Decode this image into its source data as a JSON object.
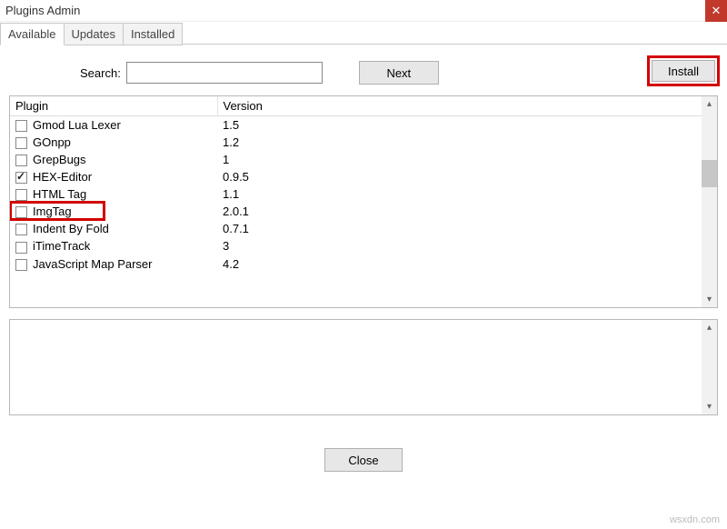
{
  "window": {
    "title": "Plugins Admin"
  },
  "tabs": [
    {
      "label": "Available",
      "active": true
    },
    {
      "label": "Updates",
      "active": false
    },
    {
      "label": "Installed",
      "active": false
    }
  ],
  "search": {
    "label": "Search:",
    "value": "",
    "next_label": "Next"
  },
  "buttons": {
    "install": "Install",
    "close": "Close"
  },
  "columns": {
    "plugin": "Plugin",
    "version": "Version"
  },
  "plugins": [
    {
      "name": "Gmod Lua Lexer",
      "version": "1.5",
      "checked": false
    },
    {
      "name": "GOnpp",
      "version": "1.2",
      "checked": false
    },
    {
      "name": "GrepBugs",
      "version": "1",
      "checked": false
    },
    {
      "name": "HEX-Editor",
      "version": "0.9.5",
      "checked": true
    },
    {
      "name": "HTML Tag",
      "version": "1.1",
      "checked": false
    },
    {
      "name": "ImgTag",
      "version": "2.0.1",
      "checked": false
    },
    {
      "name": "Indent By Fold",
      "version": "0.7.1",
      "checked": false
    },
    {
      "name": "iTimeTrack",
      "version": "3",
      "checked": false
    },
    {
      "name": "JavaScript Map Parser",
      "version": "4.2",
      "checked": false
    }
  ],
  "watermark": "wsxdn.com"
}
